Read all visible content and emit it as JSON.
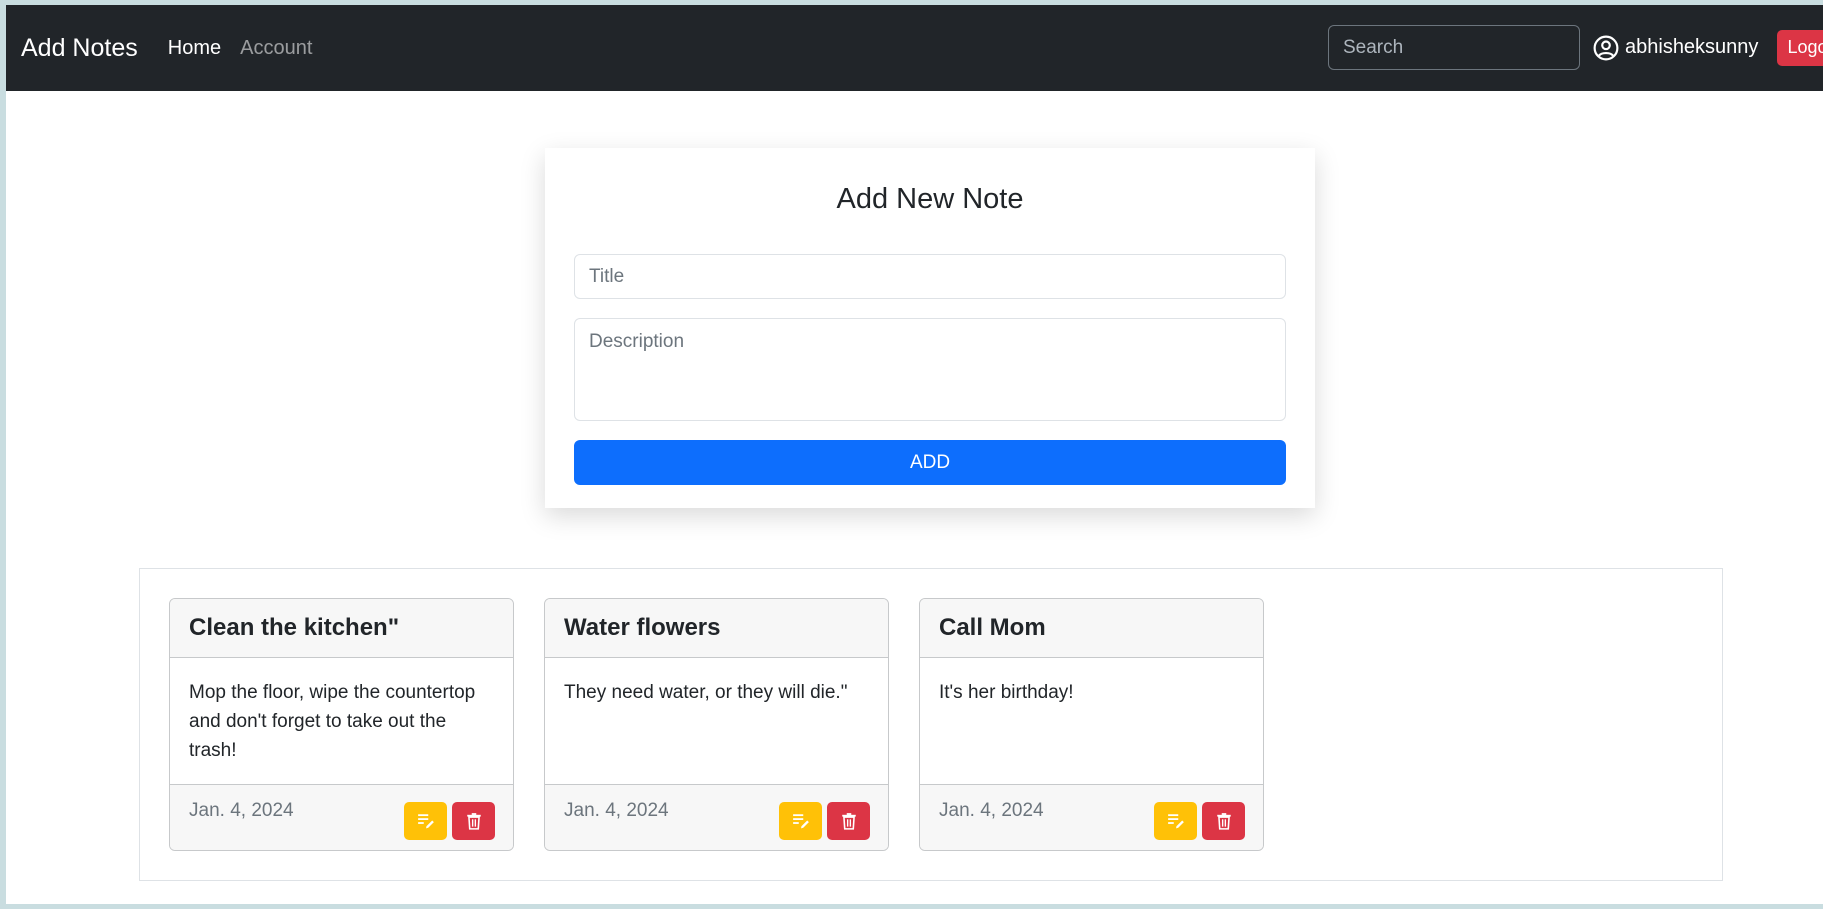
{
  "navbar": {
    "brand": "Add Notes",
    "links": [
      {
        "label": "Home",
        "active": true
      },
      {
        "label": "Account",
        "active": false
      }
    ],
    "search_placeholder": "Search",
    "username": "abhisheksunny",
    "logout_label": "Logout",
    "user_icon": "person-circle-icon"
  },
  "form": {
    "title": "Add New Note",
    "title_placeholder": "Title",
    "description_placeholder": "Description",
    "add_label": "ADD"
  },
  "notes": [
    {
      "title": "Clean the kitchen\"",
      "body": "Mop the floor, wipe the countertop and don't forget to take out the trash!",
      "date": "Jan. 4, 2024"
    },
    {
      "title": "Water flowers",
      "body": "They need water, or they will die.\"",
      "date": "Jan. 4, 2024"
    },
    {
      "title": "Call Mom",
      "body": "It's her birthday!",
      "date": "Jan. 4, 2024"
    }
  ],
  "icons": {
    "edit": "edit-note-icon",
    "delete": "trash-icon"
  },
  "colors": {
    "navbar": "#212529",
    "primary": "#0d6efd",
    "danger": "#dc3545",
    "warning": "#ffc107"
  }
}
